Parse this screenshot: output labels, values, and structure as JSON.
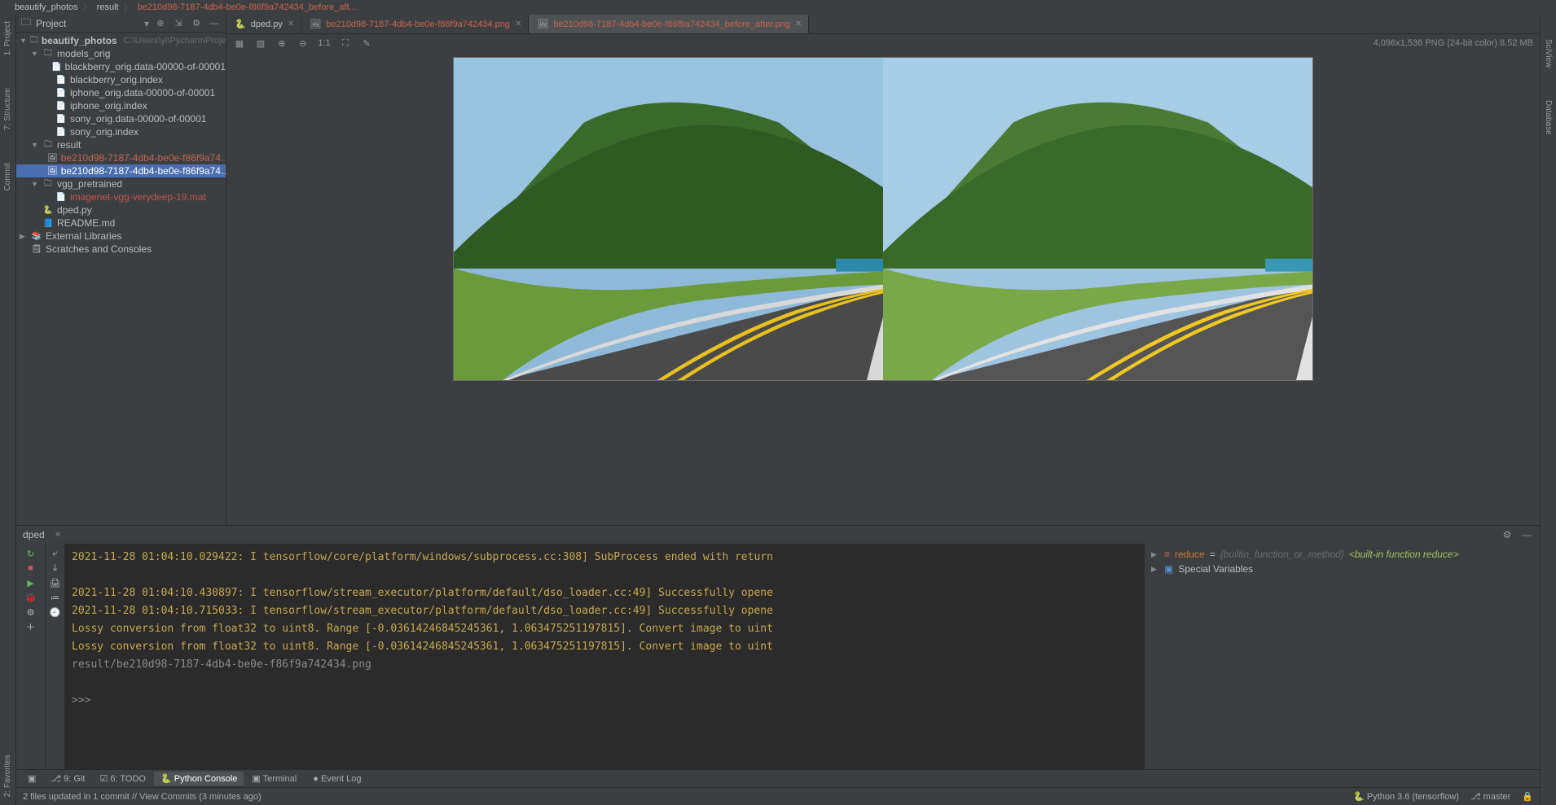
{
  "breadcrumb": {
    "root": "beautify_photos",
    "part1": "result",
    "part2": "be210d98-7187-4db4-be0e-f86f9a742434_before_aft..."
  },
  "project_header": {
    "title": "Project"
  },
  "tree": {
    "root": "beautify_photos",
    "root_hint": "C:\\Users\\yi\\PycharmProje",
    "models_orig": "models_orig",
    "blackberry_data": "blackberry_orig.data-00000-of-00001",
    "blackberry_index": "blackberry_orig.index",
    "iphone_data": "iphone_orig.data-00000-of-00001",
    "iphone_index": "iphone_orig.index",
    "sony_data": "sony_orig.data-00000-of-00001",
    "sony_index": "sony_orig.index",
    "result": "result",
    "result_f1": "be210d98-7187-4db4-be0e-f86f9a74…",
    "result_f2": "be210d98-7187-4db4-be0e-f86f9a74…",
    "vgg": "vgg_pretrained",
    "vgg_file": "imagenet-vgg-verydeep-19.mat",
    "dped": "dped.py",
    "readme": "README.md",
    "ext_libs": "External Libraries",
    "scratches": "Scratches and Consoles"
  },
  "tabs": {
    "t1": "dped.py",
    "t2": "be210d98-7187-4db4-be0e-f86f9a742434.png",
    "t3": "be210d98-7187-4db4-be0e-f86f9a742434_before_after.png"
  },
  "image_toolbar": {
    "zoom": "1:1",
    "info": "4,096x1,536 PNG (24-bit color) 8.52 MB"
  },
  "tool_header": {
    "tab": "dped"
  },
  "console": {
    "l1": "2021-11-28 01:04:10.029422: I tensorflow/core/platform/windows/subprocess.cc:308] SubProcess ended with return",
    "l2": "2021-11-28 01:04:10.430897: I tensorflow/stream_executor/platform/default/dso_loader.cc:49] Successfully opene",
    "l3": "2021-11-28 01:04:10.715033: I tensorflow/stream_executor/platform/default/dso_loader.cc:49] Successfully opene",
    "l4": "Lossy conversion from float32 to uint8. Range [-0.03614246845245361, 1.063475251197815]. Convert image to uint",
    "l5": "Lossy conversion from float32 to uint8. Range [-0.03614246845245361, 1.063475251197815]. Convert image to uint",
    "l6": "result/be210d98-7187-4db4-be0e-f86f9a742434.png",
    "prompt": ">>> "
  },
  "vars": {
    "reduce_key": "reduce",
    "reduce_eq": " = ",
    "reduce_type": "{builtin_function_or_method}",
    "reduce_val": "<built-in function reduce>",
    "special": "Special Variables"
  },
  "toolwindows": {
    "git": "9: Git",
    "todo": "6: TODO",
    "pyconsole": "Python Console",
    "terminal": "Terminal"
  },
  "status": {
    "commit": "2 files updated in 1 commit // View Commits (3 minutes ago)",
    "eventlog": "Event Log",
    "python": "Python 3.6 (tensorflow)",
    "branch": "master"
  },
  "left_gutter": {
    "project": "1: Project",
    "structure": "7: Structure",
    "commit": "Commit",
    "favorites": "2: Favorites"
  },
  "right_gutter": {
    "sciview": "SciView",
    "database": "Database"
  }
}
